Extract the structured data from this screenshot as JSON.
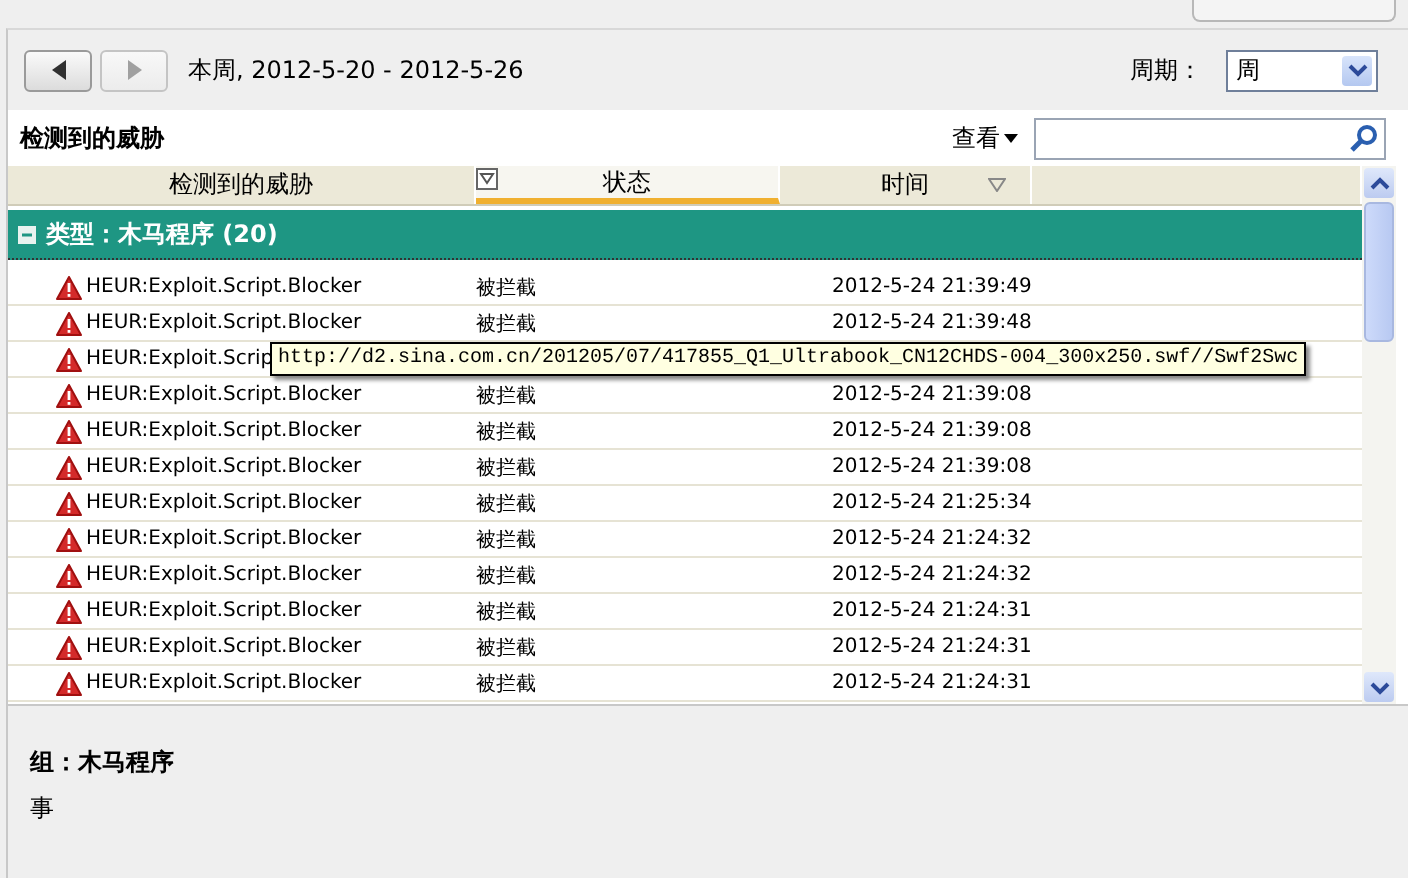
{
  "toolbar": {
    "buttons": [
      {
        "kind": "prev",
        "disabled": false
      },
      {
        "kind": "next",
        "disabled": true
      }
    ],
    "range_label": "本周, 2012-5-20 - 2012-5-26",
    "period_label": "周期：",
    "period_value": "周"
  },
  "section": {
    "title": "检测到的威胁",
    "view_menu": "查看"
  },
  "table": {
    "columns": [
      {
        "label": "检测到的威胁",
        "selected": false
      },
      {
        "label": "状态",
        "selected": true
      },
      {
        "label": "时间",
        "selected": false
      }
    ],
    "group": {
      "label": "类型：木马程序 (20)",
      "expanded": true
    },
    "rows": [
      {
        "threat": "HEUR:Exploit.Script.Blocker",
        "status": "被拦截",
        "time": "2012-5-24 21:39:49"
      },
      {
        "threat": "HEUR:Exploit.Script.Blocker",
        "status": "被拦截",
        "time": "2012-5-24 21:39:48"
      },
      {
        "threat": "HEUR:Exploit.Scrip"
      },
      {
        "threat": "HEUR:Exploit.Script.Blocker",
        "status": "被拦截",
        "time": "2012-5-24 21:39:08"
      },
      {
        "threat": "HEUR:Exploit.Script.Blocker",
        "status": "被拦截",
        "time": "2012-5-24 21:39:08"
      },
      {
        "threat": "HEUR:Exploit.Script.Blocker",
        "status": "被拦截",
        "time": "2012-5-24 21:39:08"
      },
      {
        "threat": "HEUR:Exploit.Script.Blocker",
        "status": "被拦截",
        "time": "2012-5-24 21:25:34"
      },
      {
        "threat": "HEUR:Exploit.Script.Blocker",
        "status": "被拦截",
        "time": "2012-5-24 21:24:32"
      },
      {
        "threat": "HEUR:Exploit.Script.Blocker",
        "status": "被拦截",
        "time": "2012-5-24 21:24:32"
      },
      {
        "threat": "HEUR:Exploit.Script.Blocker",
        "status": "被拦截",
        "time": "2012-5-24 21:24:31"
      },
      {
        "threat": "HEUR:Exploit.Script.Blocker",
        "status": "被拦截",
        "time": "2012-5-24 21:24:31"
      },
      {
        "threat": "HEUR:Exploit.Script.Blocker",
        "status": "被拦截",
        "time": "2012-5-24 21:24:31"
      }
    ],
    "tooltip": {
      "text": "http://d2.sina.com.cn/201205/07/417855_Q1_Ultrabook_CN12CHDS-004_300x250.swf//Swf2Swc"
    }
  },
  "details": {
    "group": "组：木马程序",
    "event": "事"
  }
}
